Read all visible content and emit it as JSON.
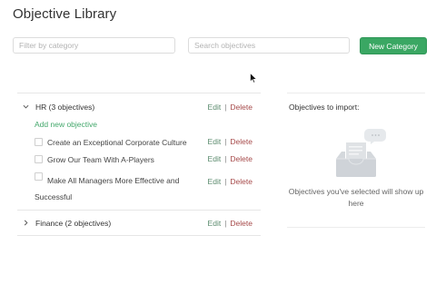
{
  "page": {
    "title": "Objective Library"
  },
  "toolbar": {
    "filter_placeholder": "Filter by category",
    "search_placeholder": "Search objectives",
    "new_category_label": "New Category"
  },
  "categories": [
    {
      "title": "HR (3 objectives)",
      "expanded": true,
      "edit_label": "Edit",
      "separator": "|",
      "delete_label": "Delete",
      "add_label": "Add new objective",
      "objectives": [
        {
          "label": "Create an Exceptional Corporate Culture",
          "edit_label": "Edit",
          "delete_label": "Delete"
        },
        {
          "label": "Grow Our Team With A-Players",
          "edit_label": "Edit",
          "delete_label": "Delete"
        },
        {
          "label": "Make All Managers More Effective and Successful",
          "edit_label": "Edit",
          "delete_label": "Delete"
        }
      ]
    },
    {
      "title": "Finance (2 objectives)",
      "expanded": false,
      "edit_label": "Edit",
      "separator": "|",
      "delete_label": "Delete"
    }
  ],
  "import_panel": {
    "title": "Objectives to import:",
    "empty_message": "Objectives you've selected will show up here",
    "icon": "inbox-icon"
  },
  "colors": {
    "primary": "#3aa763",
    "edit": "#5a8a6c",
    "delete": "#a64a4a",
    "add_link": "#44a86c"
  }
}
